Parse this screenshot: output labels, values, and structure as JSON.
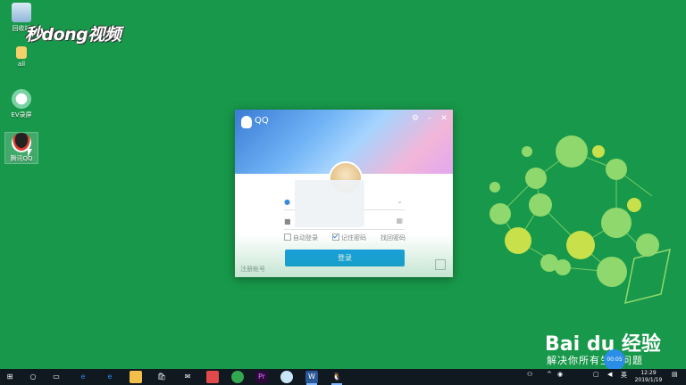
{
  "watermark": {
    "text": "秒dong视频"
  },
  "desktop_icons": [
    {
      "name": "recycle-bin",
      "label": "回收站"
    },
    {
      "name": "folder-all",
      "label": "all"
    },
    {
      "name": "ev-recorder",
      "label": "EV录屏"
    },
    {
      "name": "tencent-qq",
      "label": "腾讯QQ"
    }
  ],
  "qq_window": {
    "title": "QQ",
    "auto_login_label": "自动登录",
    "remember_password_label": "记住密码",
    "retrieve_password_label": "找回密码",
    "login_button_label": "登录",
    "register_label": "注册帐号",
    "remember_password_checked": true,
    "auto_login_checked": false
  },
  "baidu": {
    "logo_text": "Bai du 经验",
    "slogan": "解决你所有生活问题",
    "timer": "00:05"
  },
  "taskbar": {
    "clock_time": "12:29",
    "clock_date": "2019/1/19",
    "ime_label": "英"
  },
  "colors": {
    "desktop": "#18984a",
    "qq_button": "#19a0e6",
    "baidu_timer": "#2a8de6",
    "taskbar": "#101820"
  }
}
